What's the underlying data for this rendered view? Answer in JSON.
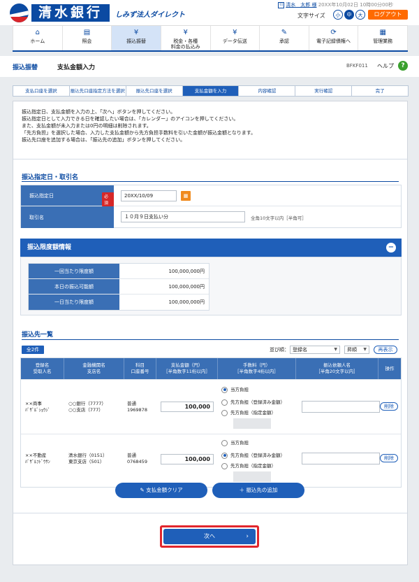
{
  "header": {
    "bank_name": "清水銀行",
    "service_name": "しみず法人ダイレクト",
    "user_icon_text": "ﾏｽ",
    "user_name": "清水　太郎 様",
    "last_login": "20XX年10月02日 10時00分00秒",
    "font_size_label": "文字サイズ",
    "font_sizes": [
      "小",
      "中",
      "大"
    ],
    "active_font_size": "中",
    "logout_label": "ログアウト"
  },
  "nav": [
    {
      "label": "ホーム",
      "icon": "home-icon"
    },
    {
      "label": "照会",
      "icon": "document-icon"
    },
    {
      "label": "振込振替",
      "icon": "yen-transfer-icon",
      "active": true
    },
    {
      "label": "税金・各種\n料金の払込み",
      "icon": "yen-circle-icon"
    },
    {
      "label": "データ伝送",
      "icon": "yen-data-icon"
    },
    {
      "label": "承認",
      "icon": "approve-icon"
    },
    {
      "label": "電子記録債権へ",
      "icon": "refresh-icon"
    },
    {
      "label": "管理業務",
      "icon": "management-icon"
    }
  ],
  "title": {
    "category": "振込振替",
    "page": "支払金額入力",
    "page_id": "BFKF011",
    "help_label": "ヘルプ",
    "help_icon": "?"
  },
  "steps": [
    "支払口座を選択",
    "振込先口座指定方法を選択",
    "振込先口座を選択",
    "支払金額を入力",
    "内容確認",
    "実行確認",
    "完了"
  ],
  "active_step": 3,
  "intro": [
    "振込指定日、支払金額を入力の上、「次へ」ボタンを押してください。",
    "振込指定日として入力できる日を確認したい場合は、「カレンダー」のアイコンを押してください。",
    "また、支払金額が未入力または0円の明細は削除されます。",
    "「先方負担」を選択した場合、入力した支払金額から先方負担手数料を引いた金額が振込金額となります。",
    "振込先口座を追加する場合は、「振込先の追加」ボタンを押してください。"
  ],
  "section_date": {
    "title": "振込指定日・取引名",
    "date_label": "振込指定日",
    "required_label": "必須",
    "date_value": "20XX/10/09",
    "calendar_icon": "calendar-icon",
    "txn_label": "取引名",
    "txn_value": "１０月９日支払い分",
    "txn_note": "全角10文字以内［半角可］"
  },
  "section_limit": {
    "title": "振込限度額情報",
    "collapse_icon": "−",
    "rows": [
      {
        "label": "一回当たり限度額",
        "value": "100,000,000円"
      },
      {
        "label": "本日の振込可能額",
        "value": "100,000,000円"
      },
      {
        "label": "一日当たり限度額",
        "value": "100,000,000円"
      }
    ]
  },
  "section_payees": {
    "title": "振込先一覧",
    "count_label": "全2件",
    "sort_label": "並び順：",
    "sort_key": "登録名",
    "sort_order": "昇順",
    "redisplay_label": "再表示",
    "columns": [
      {
        "l1": "登録名",
        "l2": "受取人名"
      },
      {
        "l1": "金融機関名",
        "l2": "支店名"
      },
      {
        "l1": "科目",
        "l2": "口座番号"
      },
      {
        "l1": "支払金額（円）",
        "l2": "［半角数字11桁以内］"
      },
      {
        "l1": "手数料（円）",
        "l2": "［半角数字4桁以内］"
      },
      {
        "l1": "振込依頼人名",
        "l2": "［半角20文字以内］"
      },
      {
        "l1": "操作",
        "l2": ""
      }
    ],
    "fee_options": [
      "当方負担",
      "先方負担（登録済み金額）",
      "先方負担（指定金額）"
    ],
    "rows": [
      {
        "reg_name": "××商事",
        "payee_kana": "ﾊﾞｻﾞﾙﾞｼｮｳｼﾞ",
        "bank": "○○銀行（7777）",
        "branch": "○○支店（777）",
        "acct_type": "普通",
        "acct_no": "1969878",
        "amount": "100,000",
        "fee_selected": 0,
        "delete_label": "削除"
      },
      {
        "reg_name": "××不動産",
        "payee_kana": "ﾊﾞｻﾞﾙﾌﾄﾞｳｻﾝ",
        "bank": "清水銀行（0151）",
        "branch": "東京支店（501）",
        "acct_type": "普通",
        "acct_no": "0768459",
        "amount": "100,000",
        "fee_selected": 1,
        "delete_label": "削除"
      }
    ],
    "clear_label": "支払金額クリア",
    "add_label": "振込先の追加"
  },
  "next_label": "次へ"
}
